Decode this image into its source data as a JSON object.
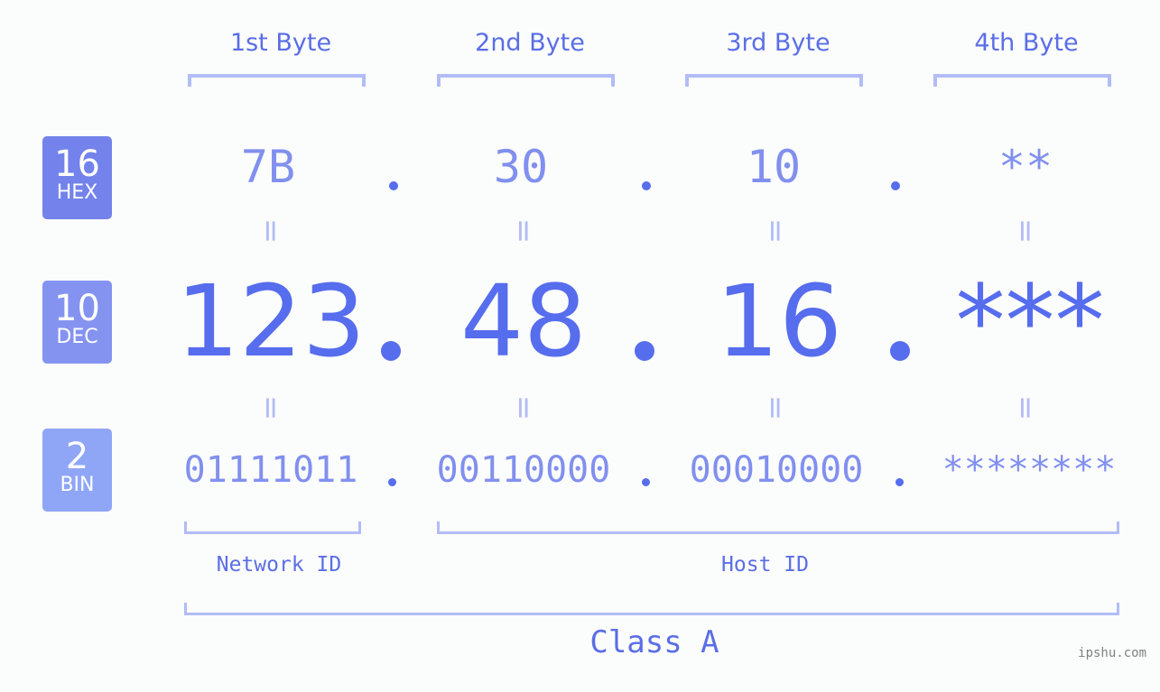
{
  "byte_headers": [
    "1st Byte",
    "2nd Byte",
    "3rd Byte",
    "4th Byte"
  ],
  "badges": [
    {
      "number": "16",
      "label": "HEX",
      "color": "#7383eb"
    },
    {
      "number": "10",
      "label": "DEC",
      "color": "#8493f0"
    },
    {
      "number": "2",
      "label": "BIN",
      "color": "#8fa6f7"
    }
  ],
  "hex": [
    "7B",
    "30",
    "10",
    "**"
  ],
  "dec": [
    "123",
    "48",
    "16",
    "***"
  ],
  "bin": [
    "01111011",
    "00110000",
    "00010000",
    "********"
  ],
  "equals_glyph": "=",
  "segments": {
    "network": "Network ID",
    "host": "Host ID",
    "class": "Class A"
  },
  "watermark": "ipshu.com",
  "colors": {
    "accent": "#566ded",
    "light_accent": "#8190ee",
    "bracket": "#b2bcf6"
  }
}
